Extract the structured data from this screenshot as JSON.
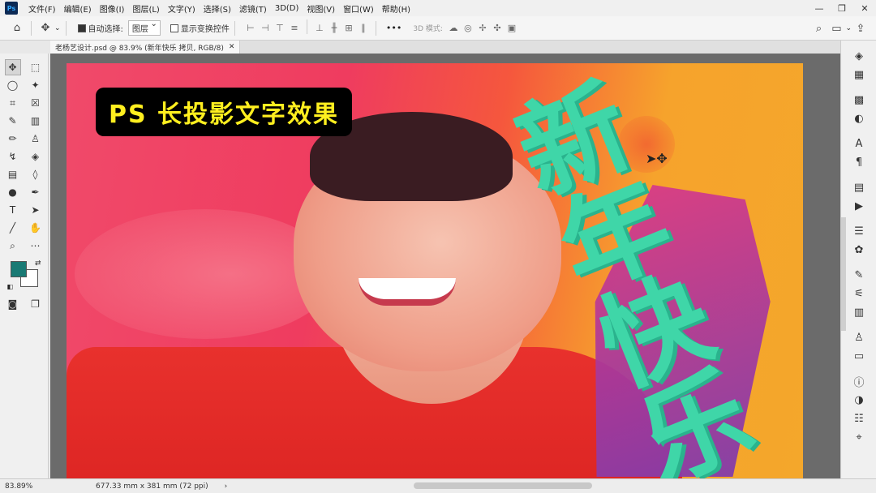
{
  "app": {
    "logo": "Ps"
  },
  "menu": [
    "文件(F)",
    "编辑(E)",
    "图像(I)",
    "图层(L)",
    "文字(Y)",
    "选择(S)",
    "滤镜(T)",
    "3D(D)",
    "视图(V)",
    "窗口(W)",
    "帮助(H)"
  ],
  "window_controls": {
    "minimize": "—",
    "restore": "❐",
    "close": "✕"
  },
  "options": {
    "auto_select_label": "自动选择:",
    "auto_select_value": "图层",
    "show_transform_label": "显示变换控件",
    "more": "•••",
    "mode3d": "3D 模式:"
  },
  "tab": {
    "title": "老杨艺设计.psd @ 83.9% (新年快乐 拷贝, RGB/8)",
    "close": "✕"
  },
  "canvas": {
    "badge_text": "PS 长投影文字效果",
    "headline_chars": [
      "新",
      "年",
      "快",
      "乐"
    ]
  },
  "colors": {
    "foreground": "#1a7a74",
    "background": "#ffffff",
    "headline": "#3fd6a8",
    "badge_text": "#ffef1f"
  },
  "status": {
    "zoom": "83.89%",
    "doc_info": "677.33 mm x 381 mm (72 ppi)",
    "arrow": "›"
  }
}
